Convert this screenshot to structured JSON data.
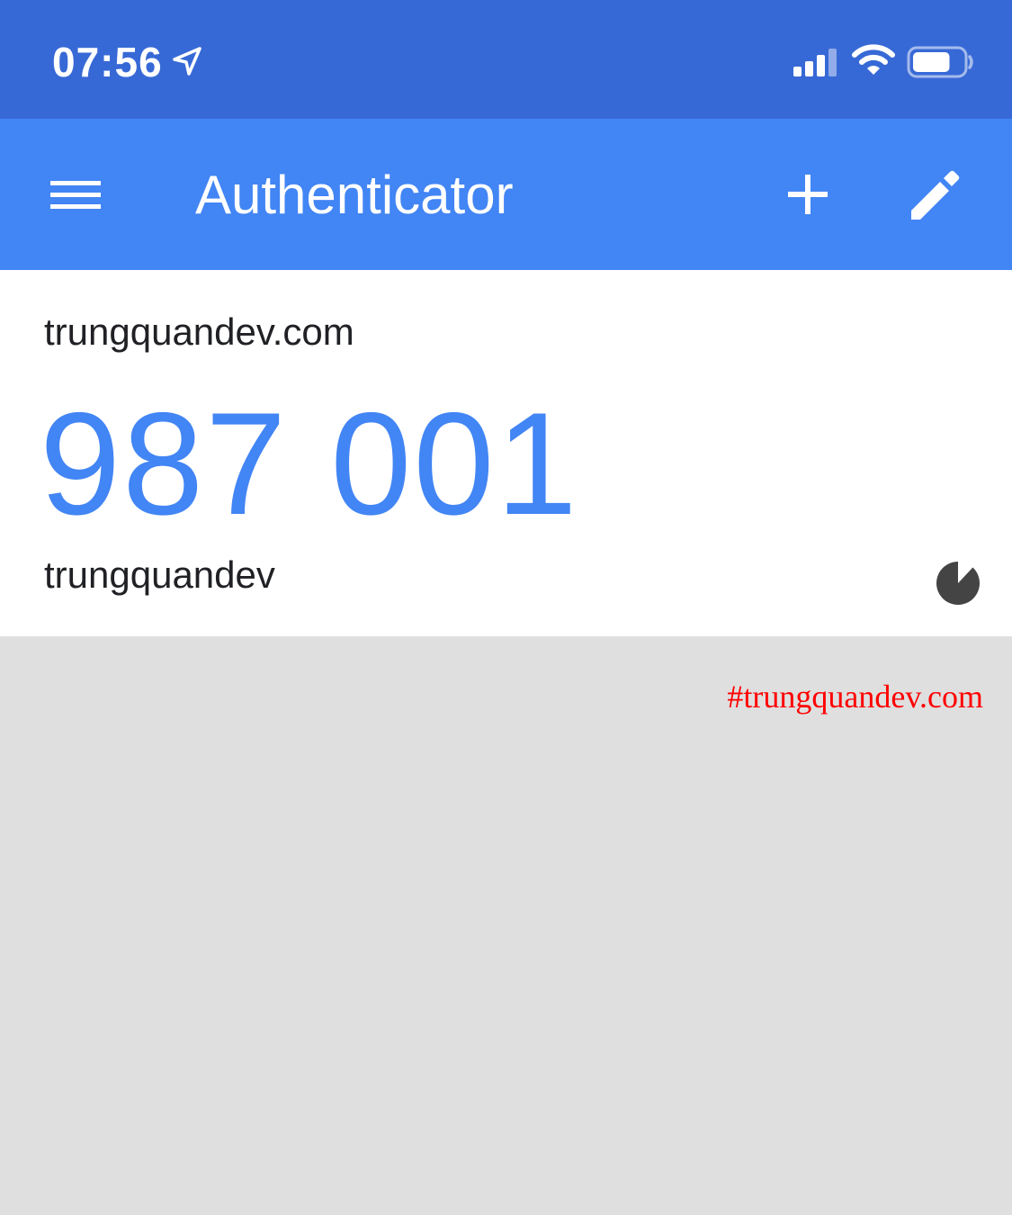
{
  "status_bar": {
    "time": "07:56",
    "icons": [
      "location-arrow-icon",
      "cellular-signal-icon",
      "wifi-icon",
      "battery-icon"
    ],
    "battery_level": 0.75
  },
  "app_bar": {
    "title": "Authenticator",
    "menu_icon": "hamburger-menu-icon",
    "add_icon": "plus-icon",
    "edit_icon": "pencil-icon"
  },
  "accounts": [
    {
      "issuer": "trungquandev.com",
      "code": "987 001",
      "name": "trungquandev",
      "time_remaining_fraction": 0.88
    }
  ],
  "watermark": "#trungquandev.com",
  "colors": {
    "status_bar": "#3769d6",
    "app_bar": "#4285f4",
    "code": "#4285f4",
    "background": "#dfdfdf",
    "watermark": "#ff0000",
    "timer": "#444444"
  }
}
